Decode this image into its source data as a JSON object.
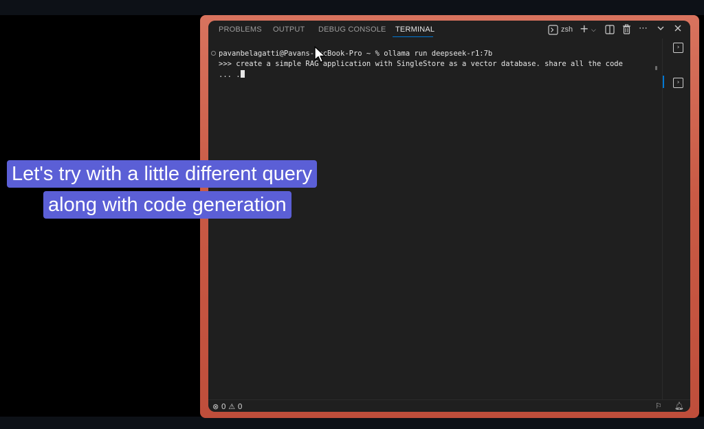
{
  "panel": {
    "tabs": [
      {
        "label": "PROBLEMS"
      },
      {
        "label": "OUTPUT"
      },
      {
        "label": "DEBUG CONSOLE"
      },
      {
        "label": "TERMINAL"
      }
    ],
    "active_tab": "TERMINAL",
    "shell_label": "zsh"
  },
  "terminal": {
    "lines": [
      "pavanbelagatti@Pavans-MacBook-Pro ~ % ollama run deepseek-r1:7b",
      ">>> create a simple RAG application with SingleStore as a vector database. share all the code",
      "... ."
    ]
  },
  "status_bar": {
    "problems": "⊗ 0 ⚠ 0"
  },
  "caption": {
    "line1": "Let's try with a little different query",
    "line2": "along with code generation"
  },
  "icons": {
    "terminal": "terminal-icon",
    "add": "plus-icon",
    "split": "split-terminal-icon",
    "trash": "trash-icon",
    "more": "ellipsis-icon",
    "collapse": "chevron-down-icon",
    "close": "close-icon"
  },
  "colors": {
    "frame": "#c95a45",
    "editor_bg": "#1f1f1f",
    "accent": "#0078d4",
    "caption_bg": "#5b5fd6"
  }
}
